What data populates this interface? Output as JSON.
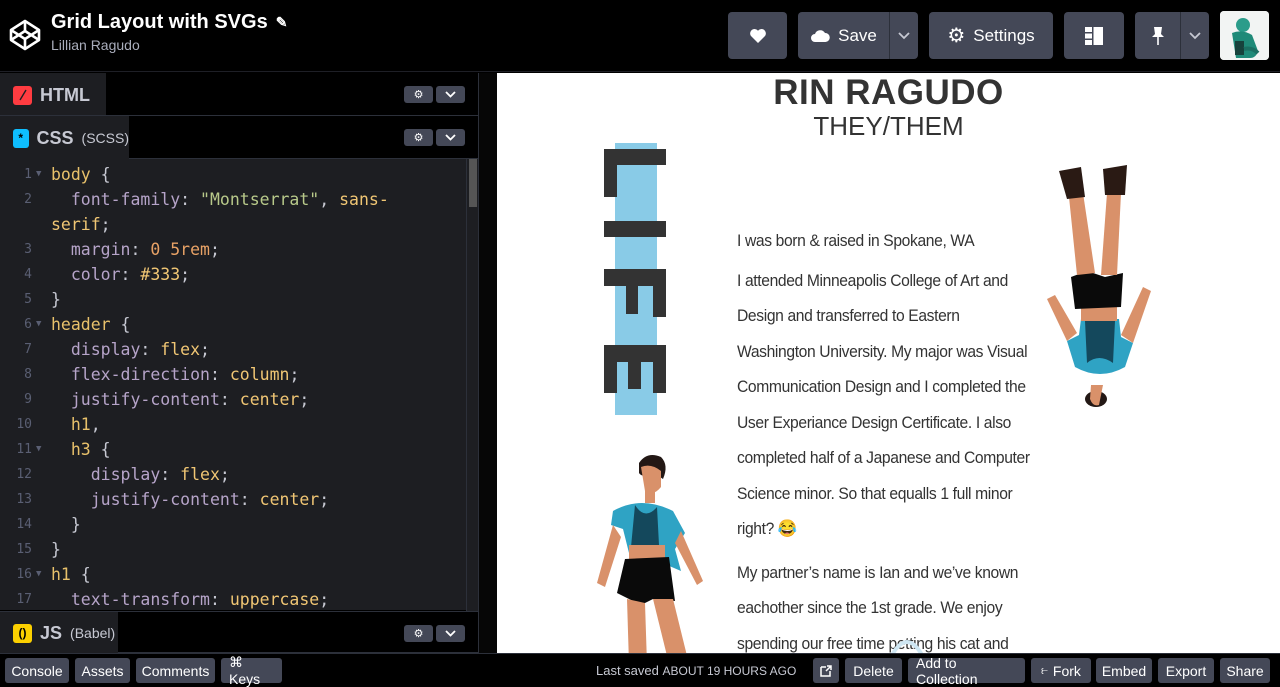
{
  "header": {
    "pen_title": "Grid Layout with SVGs",
    "author": "Lillian Ragudo",
    "edit_icon": "pencil-icon",
    "buttons": {
      "love_icon": "heart-icon",
      "save_label": "Save",
      "save_icon": "cloud-icon",
      "settings_label": "Settings",
      "settings_icon": "gear-icon",
      "layout_icon": "layout-icon",
      "pin_icon": "pushpin-icon",
      "caret_icon": "chevron-down-icon"
    }
  },
  "editors": {
    "html": {
      "label": "HTML",
      "sub": ""
    },
    "css": {
      "label": "CSS",
      "sub": "(SCSS)"
    },
    "js": {
      "label": "JS",
      "sub": "(Babel)"
    },
    "css_code": [
      {
        "n": "1",
        "fold": true,
        "segs": [
          [
            "sel",
            "body"
          ],
          [
            "pun",
            " {"
          ]
        ]
      },
      {
        "n": "2",
        "fold": false,
        "segs": [
          [
            "pun",
            "  "
          ],
          [
            "prop",
            "font-family"
          ],
          [
            "pun",
            ": "
          ],
          [
            "str",
            "\"Montserrat\""
          ],
          [
            "pun",
            ", "
          ],
          [
            "val",
            "sans-"
          ]
        ]
      },
      {
        "n": "",
        "fold": false,
        "segs": [
          [
            "val",
            "serif"
          ],
          [
            "pun",
            ";"
          ]
        ]
      },
      {
        "n": "3",
        "fold": false,
        "segs": [
          [
            "pun",
            "  "
          ],
          [
            "prop",
            "margin"
          ],
          [
            "pun",
            ": "
          ],
          [
            "num2",
            "0 5rem"
          ],
          [
            "pun",
            ";"
          ]
        ]
      },
      {
        "n": "4",
        "fold": false,
        "segs": [
          [
            "pun",
            "  "
          ],
          [
            "prop",
            "color"
          ],
          [
            "pun",
            ": "
          ],
          [
            "val",
            "#333"
          ],
          [
            "pun",
            ";"
          ]
        ]
      },
      {
        "n": "5",
        "fold": false,
        "segs": [
          [
            "pun",
            "}"
          ]
        ]
      },
      {
        "n": "6",
        "fold": true,
        "segs": [
          [
            "sel",
            "header"
          ],
          [
            "pun",
            " {"
          ]
        ]
      },
      {
        "n": "7",
        "fold": false,
        "segs": [
          [
            "pun",
            "  "
          ],
          [
            "prop",
            "display"
          ],
          [
            "pun",
            ": "
          ],
          [
            "val",
            "flex"
          ],
          [
            "pun",
            ";"
          ]
        ]
      },
      {
        "n": "8",
        "fold": false,
        "segs": [
          [
            "pun",
            "  "
          ],
          [
            "prop",
            "flex-direction"
          ],
          [
            "pun",
            ": "
          ],
          [
            "val",
            "column"
          ],
          [
            "pun",
            ";"
          ]
        ]
      },
      {
        "n": "9",
        "fold": false,
        "segs": [
          [
            "pun",
            "  "
          ],
          [
            "prop",
            "justify-content"
          ],
          [
            "pun",
            ": "
          ],
          [
            "val",
            "center"
          ],
          [
            "pun",
            ";"
          ]
        ]
      },
      {
        "n": "10",
        "fold": false,
        "segs": [
          [
            "pun",
            "  "
          ],
          [
            "sel",
            "h1"
          ],
          [
            "pun",
            ","
          ]
        ]
      },
      {
        "n": "11",
        "fold": true,
        "segs": [
          [
            "pun",
            "  "
          ],
          [
            "sel",
            "h3"
          ],
          [
            "pun",
            " {"
          ]
        ]
      },
      {
        "n": "12",
        "fold": false,
        "segs": [
          [
            "pun",
            "    "
          ],
          [
            "prop",
            "display"
          ],
          [
            "pun",
            ": "
          ],
          [
            "val",
            "flex"
          ],
          [
            "pun",
            ";"
          ]
        ]
      },
      {
        "n": "13",
        "fold": false,
        "segs": [
          [
            "pun",
            "    "
          ],
          [
            "prop",
            "justify-content"
          ],
          [
            "pun",
            ": "
          ],
          [
            "val",
            "center"
          ],
          [
            "pun",
            ";"
          ]
        ]
      },
      {
        "n": "14",
        "fold": false,
        "segs": [
          [
            "pun",
            "  }"
          ]
        ]
      },
      {
        "n": "15",
        "fold": false,
        "segs": [
          [
            "pun",
            "}"
          ]
        ]
      },
      {
        "n": "16",
        "fold": true,
        "segs": [
          [
            "sel",
            "h1"
          ],
          [
            "pun",
            " {"
          ]
        ]
      },
      {
        "n": "17",
        "fold": false,
        "segs": [
          [
            "pun",
            "  "
          ],
          [
            "prop",
            "text-transform"
          ],
          [
            "pun",
            ": "
          ],
          [
            "val",
            "uppercase"
          ],
          [
            "pun",
            ";"
          ]
        ]
      }
    ]
  },
  "preview": {
    "name": "RIN RAGUDO",
    "pronouns": "THEY/THEM",
    "vertical_word": "LIFE",
    "paragraphs": [
      "I was born & raised in Spokane, WA",
      "I attended Minneapolis College of Art and Design and transferred to Eastern Washington University. My major was Visual Communication Design and I completed the User Experiance Design Certificate. I also completed half of a Japanese and Computer Science minor. So that equalls 1 full minor right? 😂",
      "My partner’s name is Ian and we’ve known eachother since the 1st grade. We enjoy spending our free time petting his cat and"
    ],
    "colors": {
      "accent_blue": "#89cbe7",
      "text": "#333333",
      "skin": "#d9916a",
      "teal": "#2fa3c4",
      "dark_teal": "#14485c"
    }
  },
  "footer": {
    "left_buttons": [
      "Console",
      "Assets",
      "Comments",
      "⌘ Keys"
    ],
    "last_saved_prefix": "Last saved",
    "last_saved_time": "ABOUT 19 HOURS AGO",
    "right_buttons": [
      "Delete",
      "Add to Collection",
      "Fork",
      "Embed",
      "Export",
      "Share"
    ],
    "external_icon": "external-link-icon",
    "fork_icon": "fork-icon"
  }
}
